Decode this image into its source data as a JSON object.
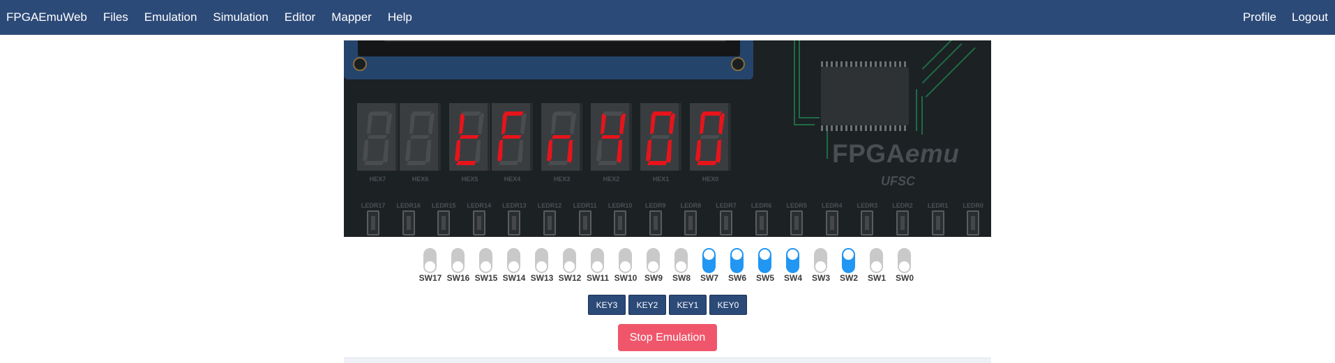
{
  "navbar": {
    "brand": "FPGAEmuWeb",
    "menu": [
      "Files",
      "Emulation",
      "Simulation",
      "Editor",
      "Mapper",
      "Help"
    ],
    "right": [
      "Profile",
      "Logout"
    ],
    "background": "#2c4a78"
  },
  "board": {
    "logo_main": "FPGA",
    "logo_emu": "emu",
    "logo_sub": "UFSC",
    "hex_labels": [
      "HEX7",
      "HEX6",
      "HEX5",
      "HEX4",
      "HEX3",
      "HEX2",
      "HEX1",
      "HEX0"
    ],
    "hex_segments": [
      [],
      [],
      [
        "d",
        "e",
        "f",
        "g"
      ],
      [
        "a",
        "e",
        "f",
        "g"
      ],
      [
        "c",
        "e",
        "g"
      ],
      [
        "b",
        "c",
        "f",
        "g"
      ],
      [
        "a",
        "b",
        "c",
        "d",
        "e",
        "f"
      ],
      [
        "a",
        "b",
        "c",
        "d",
        "e",
        "f"
      ]
    ],
    "segment_on_color": "#e8141b",
    "segment_off_color": "#4a4d50",
    "led_labels": [
      "LEDR17",
      "LEDR16",
      "LEDR15",
      "LEDR14",
      "LEDR13",
      "LEDR12",
      "LEDR11",
      "LEDR10",
      "LEDR9",
      "LEDR8",
      "LEDR7",
      "LEDR6",
      "LEDR5",
      "LEDR4",
      "LEDR3",
      "LEDR2",
      "LEDR1",
      "LEDR0"
    ]
  },
  "switches": [
    {
      "label": "SW17",
      "on": false
    },
    {
      "label": "SW16",
      "on": false
    },
    {
      "label": "SW15",
      "on": false
    },
    {
      "label": "SW14",
      "on": false
    },
    {
      "label": "SW13",
      "on": false
    },
    {
      "label": "SW12",
      "on": false
    },
    {
      "label": "SW11",
      "on": false
    },
    {
      "label": "SW10",
      "on": false
    },
    {
      "label": "SW9",
      "on": false
    },
    {
      "label": "SW8",
      "on": false
    },
    {
      "label": "SW7",
      "on": true
    },
    {
      "label": "SW6",
      "on": true
    },
    {
      "label": "SW5",
      "on": true
    },
    {
      "label": "SW4",
      "on": true
    },
    {
      "label": "SW3",
      "on": false
    },
    {
      "label": "SW2",
      "on": true
    },
    {
      "label": "SW1",
      "on": false
    },
    {
      "label": "SW0",
      "on": false
    }
  ],
  "keys": [
    "KEY3",
    "KEY2",
    "KEY1",
    "KEY0"
  ],
  "stop_button": "Stop Emulation",
  "colors": {
    "switch_on": "#2196f3",
    "switch_off": "#c9c9c9",
    "stop": "#f0566b"
  }
}
